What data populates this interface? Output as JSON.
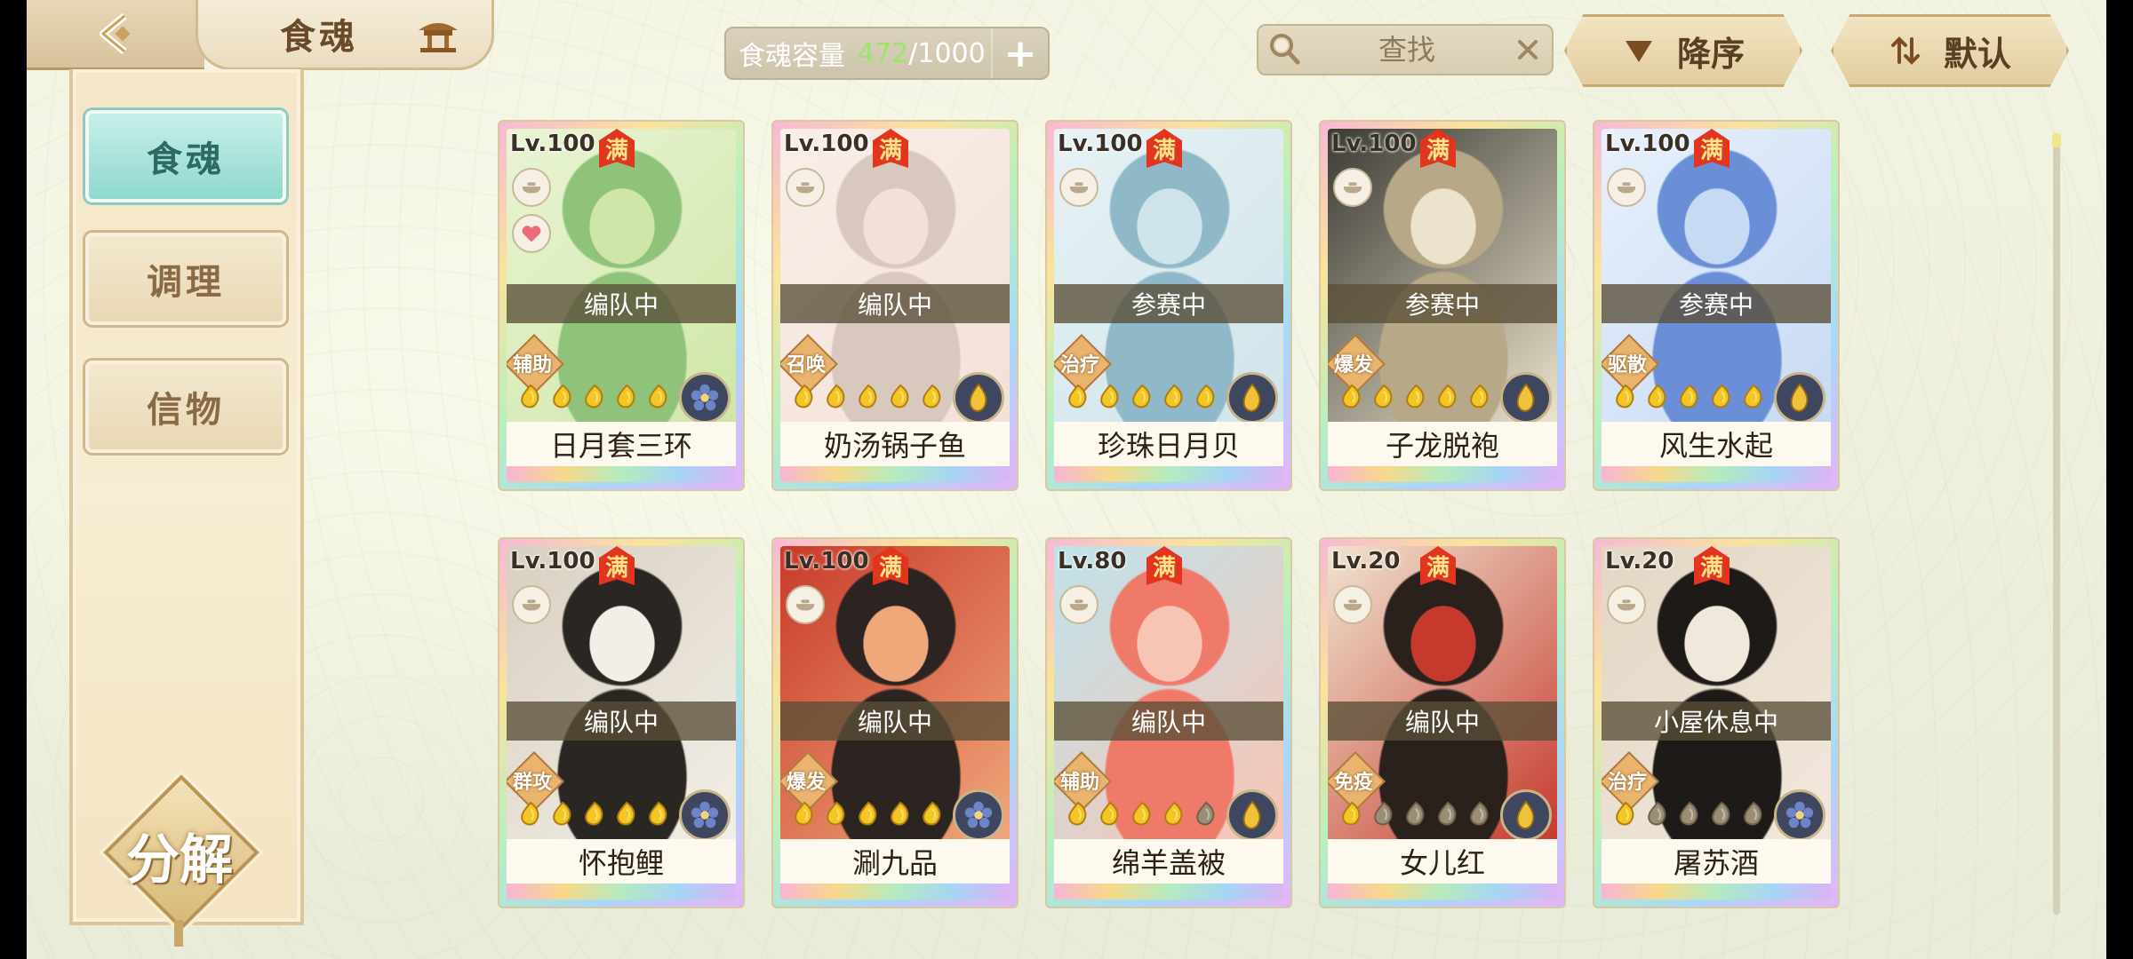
{
  "header": {
    "title": "食魂",
    "capacity_label": "食魂容量",
    "capacity_current": "472",
    "capacity_max": "/1000",
    "capacity_plus": "+",
    "search_placeholder": "查找",
    "sort_label": "降序",
    "filter_label": "默认"
  },
  "sidebar": {
    "items": [
      {
        "label": "食魂",
        "active": true
      },
      {
        "label": "调理",
        "active": false
      },
      {
        "label": "信物",
        "active": false
      }
    ],
    "decompose_label": "分解"
  },
  "cards": [
    {
      "level": "Lv.100",
      "badge": "满",
      "status": "编队中",
      "role": "辅助",
      "name": "日月套三环",
      "stars_filled": 5,
      "heart": true,
      "element": "blue-flower"
    },
    {
      "level": "Lv.100",
      "badge": "满",
      "status": "编队中",
      "role": "召唤",
      "name": "奶汤锅子鱼",
      "stars_filled": 5,
      "heart": false,
      "element": "gold-flower"
    },
    {
      "level": "Lv.100",
      "badge": "满",
      "status": "参赛中",
      "role": "治疗",
      "name": "珍珠日月贝",
      "stars_filled": 5,
      "heart": false,
      "element": "gold-flower"
    },
    {
      "level": "Lv.100",
      "badge": "满",
      "status": "参赛中",
      "role": "爆发",
      "name": "子龙脱袍",
      "stars_filled": 5,
      "heart": false,
      "element": "gold-flower"
    },
    {
      "level": "Lv.100",
      "badge": "满",
      "status": "参赛中",
      "role": "驱散",
      "name": "风生水起",
      "stars_filled": 5,
      "heart": false,
      "element": "gold-drop"
    },
    {
      "level": "Lv.100",
      "badge": "满",
      "status": "编队中",
      "role": "群攻",
      "name": "怀抱鲤",
      "stars_filled": 5,
      "heart": false,
      "element": "blue-flower"
    },
    {
      "level": "Lv.100",
      "badge": "满",
      "status": "编队中",
      "role": "爆发",
      "name": "涮九品",
      "stars_filled": 5,
      "heart": false,
      "element": "blue-flower"
    },
    {
      "level": "Lv.80",
      "badge": "满",
      "status": "编队中",
      "role": "辅助",
      "name": "绵羊盖被",
      "stars_filled": 4,
      "heart": false,
      "element": "gold-drop"
    },
    {
      "level": "Lv.20",
      "badge": "满",
      "status": "编队中",
      "role": "免疫",
      "name": "女儿红",
      "stars_filled": 1,
      "heart": false,
      "element": "gold-drop"
    },
    {
      "level": "Lv.20",
      "badge": "满",
      "status": "小屋休息中",
      "role": "治疗",
      "name": "屠苏酒",
      "stars_filled": 1,
      "heart": false,
      "element": "blue-flower"
    }
  ],
  "colors": {
    "accent_teal": "#8fd8ce",
    "badge_red": "#e2351e",
    "capacity_green": "#9be66a"
  }
}
